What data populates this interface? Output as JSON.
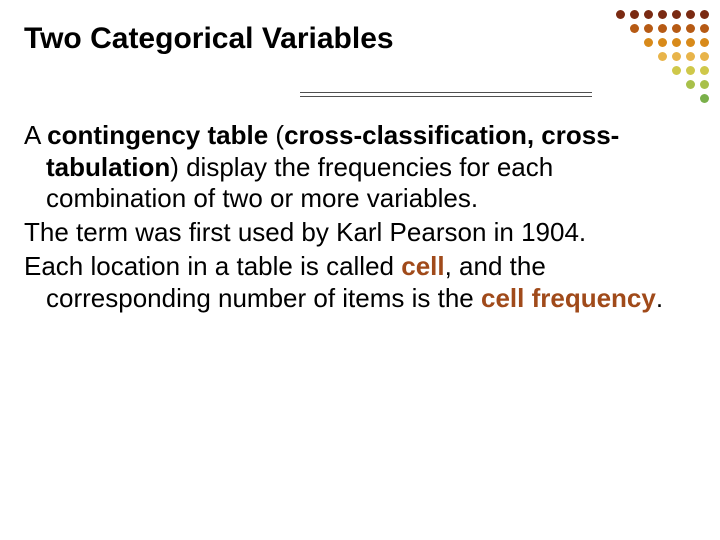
{
  "title": "Two Categorical Variables",
  "body": {
    "p1": {
      "lead": "A ",
      "term1": "contingency table",
      "mid1": " (",
      "term2": "cross-classification, cross-tabulation",
      "tail": ") display the frequencies for each combination of two or more variables."
    },
    "p2": "The term was first used by Karl Pearson in 1904.",
    "p3": {
      "lead": "Each location in a table is called ",
      "term1": "cell",
      "mid": ", and the corresponding number of items is the ",
      "term2": "cell frequency",
      "tail": "."
    }
  },
  "decor": {
    "rows": [
      [
        "#7a2a12",
        "#7a2a12",
        "#7a2a12",
        "#7a2a12",
        "#7a2a12",
        "#7a2a12",
        "#7a2a12"
      ],
      [
        "",
        "#b65a14",
        "#b65a14",
        "#b65a14",
        "#b65a14",
        "#b65a14",
        "#b65a14"
      ],
      [
        "",
        "",
        "#d88a1a",
        "#d88a1a",
        "#d88a1a",
        "#d88a1a",
        "#d88a1a"
      ],
      [
        "",
        "",
        "",
        "#e8b44a",
        "#e8b44a",
        "#e8b44a",
        "#e8b44a"
      ],
      [
        "",
        "",
        "",
        "",
        "#cfc84a",
        "#cfc84a",
        "#cfc84a"
      ],
      [
        "",
        "",
        "",
        "",
        "",
        "#a8c04a",
        "#a8c04a"
      ],
      [
        "",
        "",
        "",
        "",
        "",
        "",
        "#7ab04a"
      ]
    ]
  }
}
